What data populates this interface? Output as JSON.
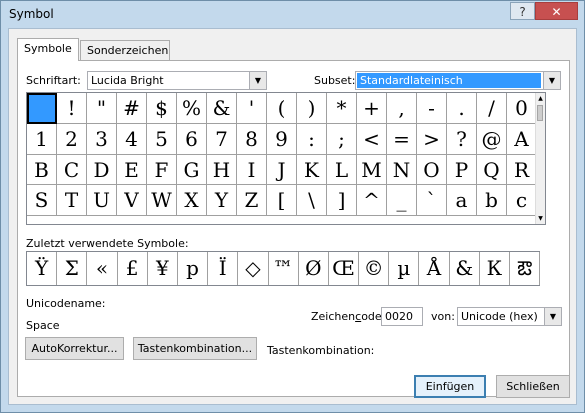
{
  "window": {
    "title": "Symbol",
    "help_label": "?",
    "close_label": "✕"
  },
  "tabs": [
    {
      "label": "Symbole",
      "active": true
    },
    {
      "label": "Sonderzeichen",
      "active": false
    }
  ],
  "font": {
    "label": "Schriftart:",
    "value": "Lucida Bright"
  },
  "subset": {
    "label": "Subset:",
    "value": "Standardlateinisch"
  },
  "symbols": [
    " ",
    "!",
    "\"",
    "#",
    "$",
    "%",
    "&",
    "'",
    "(",
    ")",
    "*",
    "+",
    ",",
    "-",
    ".",
    "/",
    "0",
    "1",
    "2",
    "3",
    "4",
    "5",
    "6",
    "7",
    "8",
    "9",
    ":",
    ";",
    "<",
    "=",
    ">",
    "?",
    "@",
    "A",
    "B",
    "C",
    "D",
    "E",
    "F",
    "G",
    "H",
    "I",
    "J",
    "K",
    "L",
    "M",
    "N",
    "O",
    "P",
    "Q",
    "R",
    "S",
    "T",
    "U",
    "V",
    "W",
    "X",
    "Y",
    "Z",
    "[",
    "\\",
    "]",
    "^",
    "_",
    "`",
    "a",
    "b",
    "c"
  ],
  "recent": {
    "label": "Zuletzt verwendete Symbole:",
    "symbols": [
      "Ÿ",
      "Σ",
      "«",
      "£",
      "¥",
      "р",
      "Ï",
      "◇",
      "™",
      "Ø",
      "Œ",
      "©",
      "µ",
      "Å",
      "&",
      "К",
      "ఔ"
    ]
  },
  "unicode_name": {
    "label": "Unicodename:",
    "value": "Space"
  },
  "char_code": {
    "label": "Zeichencode:",
    "value": "0020"
  },
  "from": {
    "label": "von:",
    "value": "Unicode (hex)"
  },
  "autocorrect_label": "AutoKorrektur...",
  "shortcut_button_label": "Tastenkombination...",
  "shortcut_label": "Tastenkombination:",
  "insert_label": "Einfügen",
  "close_label": "Schließen",
  "scroll_up": "▲",
  "scroll_down": "▼",
  "dropdown_arrow": "▼"
}
